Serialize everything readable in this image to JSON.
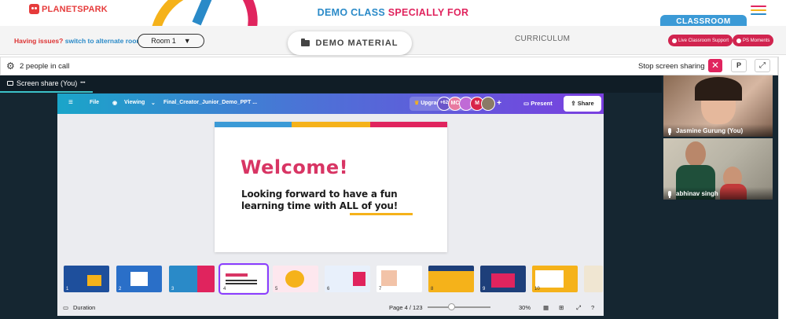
{
  "header": {
    "logo_text": "PLANETSPARK",
    "title_part1": "DEMO CLASS ",
    "title_part2": "SPECIALLY FOR",
    "classroom_tab": "CLASSROOM"
  },
  "subbar": {
    "issues_text": "Having issues?",
    "issues_link": "switch to alternate room",
    "room_value": "Room 1",
    "room_caret": "▼",
    "demo_material": "DEMO MATERIAL",
    "curriculum": "CURRICULUM",
    "live_support": "Live Classroom Support",
    "ps_moments": "PS Moments"
  },
  "callbar": {
    "people": "2 people in call",
    "stop_sharing": "Stop screen sharing",
    "close_glyph": "✕",
    "p_label": "P",
    "expand_glyph": "⤢"
  },
  "share_tab": {
    "label": "Screen share (You)",
    "more": "•••"
  },
  "canva": {
    "menu_glyph": "≡",
    "file": "File",
    "viewing": "Viewing",
    "doc_title": "Final_Creator_Junior_Demo_PPT ...",
    "upgrade": "Upgrade to Canva P...",
    "collab_count": "+62",
    "avatars": [
      "MC",
      "",
      "M",
      ""
    ],
    "plus": "+",
    "present": "Present",
    "share": "Share",
    "slide": {
      "heading": "Welcome!",
      "line1": "Looking forward to have a fun",
      "line2": "learning time with ALL of you!"
    },
    "thumb_numbers": [
      "1",
      "2",
      "3",
      "4",
      "5",
      "6",
      "7",
      "8",
      "9",
      "10"
    ],
    "duration": "Duration",
    "page": "Page 4 / 123",
    "zoom": "30%"
  },
  "participants": [
    {
      "name": "Jasmine Gurung (You)"
    },
    {
      "name": "abhinav singh"
    }
  ],
  "colors": {
    "brand_red": "#e0245e",
    "brand_blue": "#2a8ac8",
    "canva_purple": "#8b3dff",
    "stage_dark": "#152631"
  }
}
